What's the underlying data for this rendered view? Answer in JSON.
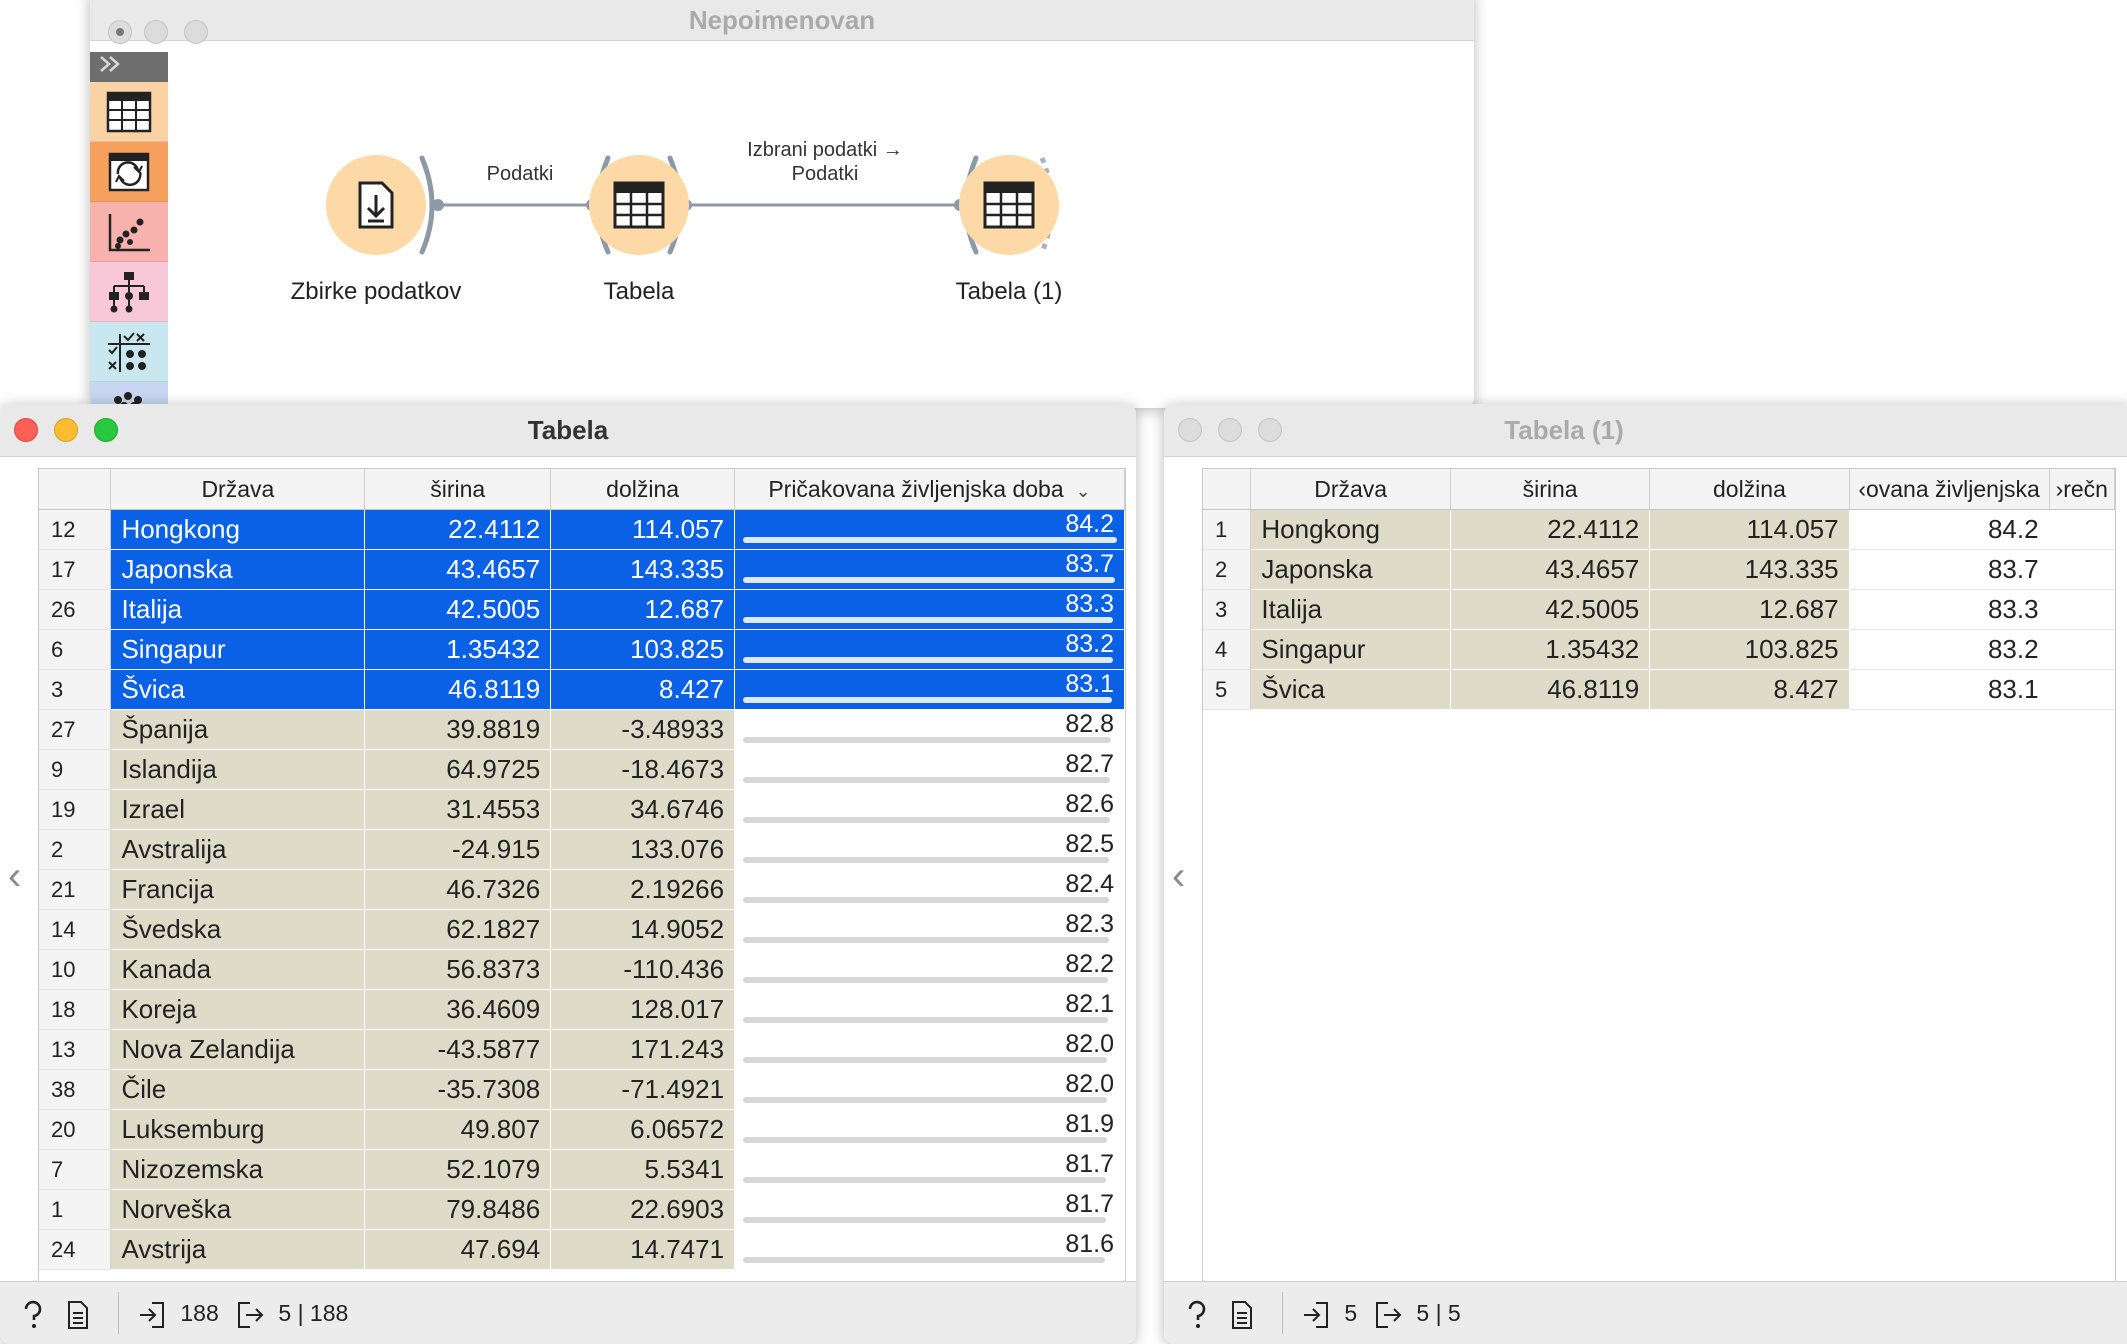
{
  "canvas": {
    "title": "Nepoimenovan",
    "toolbox_expand_icon": "double-chevron-right-icon",
    "toolbox_categories": [
      {
        "name": "data",
        "icon": "table-icon",
        "color": "#fbd2a4"
      },
      {
        "name": "transform",
        "icon": "transform-icon",
        "color": "#f7a15f"
      },
      {
        "name": "visualize",
        "icon": "scatter-icon",
        "color": "#f7b2ad"
      },
      {
        "name": "model",
        "icon": "tree-icon",
        "color": "#f8c7d8"
      },
      {
        "name": "evaluate",
        "icon": "evaluate-icon",
        "color": "#c8e7ee"
      },
      {
        "name": "unsupervised",
        "icon": "clusters-icon",
        "color": "#c8d6f1"
      }
    ],
    "nodes": [
      {
        "label": "Zbirke podatkov",
        "icon": "download-icon"
      },
      {
        "label": "Tabela",
        "icon": "table-icon"
      },
      {
        "label": "Tabela (1)",
        "icon": "table-icon"
      }
    ],
    "links": [
      {
        "label": "Podatki"
      },
      {
        "label_line1": "Izbrani podatki →",
        "label_line2": "Podatki"
      }
    ]
  },
  "tabela": {
    "title": "Tabela",
    "columns": [
      "Država",
      "širina",
      "dolžina",
      "Pričakovana življenjska doba"
    ],
    "sort_indicator": "⌄",
    "rows": [
      {
        "n": "12",
        "drzava": "Hongkong",
        "sirina": "22.4112",
        "dolzina": "114.057",
        "life": "84.2",
        "life_value": 84.2,
        "selected": true
      },
      {
        "n": "17",
        "drzava": "Japonska",
        "sirina": "43.4657",
        "dolzina": "143.335",
        "life": "83.7",
        "life_value": 83.7,
        "selected": true
      },
      {
        "n": "26",
        "drzava": "Italija",
        "sirina": "42.5005",
        "dolzina": "12.687",
        "life": "83.3",
        "life_value": 83.3,
        "selected": true
      },
      {
        "n": "6",
        "drzava": "Singapur",
        "sirina": "1.35432",
        "dolzina": "103.825",
        "life": "83.2",
        "life_value": 83.2,
        "selected": true
      },
      {
        "n": "3",
        "drzava": "Švica",
        "sirina": "46.8119",
        "dolzina": "8.427",
        "life": "83.1",
        "life_value": 83.1,
        "selected": true
      },
      {
        "n": "27",
        "drzava": "Španija",
        "sirina": "39.8819",
        "dolzina": "-3.48933",
        "life": "82.8",
        "life_value": 82.8,
        "selected": false
      },
      {
        "n": "9",
        "drzava": "Islandija",
        "sirina": "64.9725",
        "dolzina": "-18.4673",
        "life": "82.7",
        "life_value": 82.7,
        "selected": false
      },
      {
        "n": "19",
        "drzava": "Izrael",
        "sirina": "31.4553",
        "dolzina": "34.6746",
        "life": "82.6",
        "life_value": 82.6,
        "selected": false
      },
      {
        "n": "2",
        "drzava": "Avstralija",
        "sirina": "-24.915",
        "dolzina": "133.076",
        "life": "82.5",
        "life_value": 82.5,
        "selected": false
      },
      {
        "n": "21",
        "drzava": "Francija",
        "sirina": "46.7326",
        "dolzina": "2.19266",
        "life": "82.4",
        "life_value": 82.4,
        "selected": false
      },
      {
        "n": "14",
        "drzava": "Švedska",
        "sirina": "62.1827",
        "dolzina": "14.9052",
        "life": "82.3",
        "life_value": 82.3,
        "selected": false
      },
      {
        "n": "10",
        "drzava": "Kanada",
        "sirina": "56.8373",
        "dolzina": "-110.436",
        "life": "82.2",
        "life_value": 82.2,
        "selected": false
      },
      {
        "n": "18",
        "drzava": "Koreja",
        "sirina": "36.4609",
        "dolzina": "128.017",
        "life": "82.1",
        "life_value": 82.1,
        "selected": false
      },
      {
        "n": "13",
        "drzava": "Nova Zelandija",
        "sirina": "-43.5877",
        "dolzina": "171.243",
        "life": "82.0",
        "life_value": 82.0,
        "selected": false
      },
      {
        "n": "38",
        "drzava": "Čile",
        "sirina": "-35.7308",
        "dolzina": "-71.4921",
        "life": "82.0",
        "life_value": 82.0,
        "selected": false
      },
      {
        "n": "20",
        "drzava": "Luksemburg",
        "sirina": "49.807",
        "dolzina": "6.06572",
        "life": "81.9",
        "life_value": 81.9,
        "selected": false
      },
      {
        "n": "7",
        "drzava": "Nizozemska",
        "sirina": "52.1079",
        "dolzina": "5.5341",
        "life": "81.7",
        "life_value": 81.7,
        "selected": false
      },
      {
        "n": "1",
        "drzava": "Norveška",
        "sirina": "79.8486",
        "dolzina": "22.6903",
        "life": "81.7",
        "life_value": 81.7,
        "selected": false
      },
      {
        "n": "24",
        "drzava": "Avstrija",
        "sirina": "47.694",
        "dolzina": "14.7471",
        "life": "81.6",
        "life_value": 81.6,
        "selected": false
      }
    ],
    "life_bar_max": 84.2,
    "status": {
      "input_count": "188",
      "output_count": "5 | 188"
    }
  },
  "tabela1": {
    "title": "Tabela (1)",
    "columns": [
      "Država",
      "širina",
      "dolžina",
      "‹ovana življenjska",
      "›rečn"
    ],
    "rows": [
      {
        "n": "1",
        "drzava": "Hongkong",
        "sirina": "22.4112",
        "dolzina": "114.057",
        "life": "84.2"
      },
      {
        "n": "2",
        "drzava": "Japonska",
        "sirina": "43.4657",
        "dolzina": "143.335",
        "life": "83.7"
      },
      {
        "n": "3",
        "drzava": "Italija",
        "sirina": "42.5005",
        "dolzina": "12.687",
        "life": "83.3"
      },
      {
        "n": "4",
        "drzava": "Singapur",
        "sirina": "1.35432",
        "dolzina": "103.825",
        "life": "83.2"
      },
      {
        "n": "5",
        "drzava": "Švica",
        "sirina": "46.8119",
        "dolzina": "8.427",
        "life": "83.1"
      }
    ],
    "status": {
      "input_count": "5",
      "output_count": "5 | 5"
    }
  },
  "colors": {
    "selection": "#0a61e6",
    "meta_cell": "#dedcc8",
    "node_fill": "#fcd9a6",
    "link": "#8c99a6"
  }
}
